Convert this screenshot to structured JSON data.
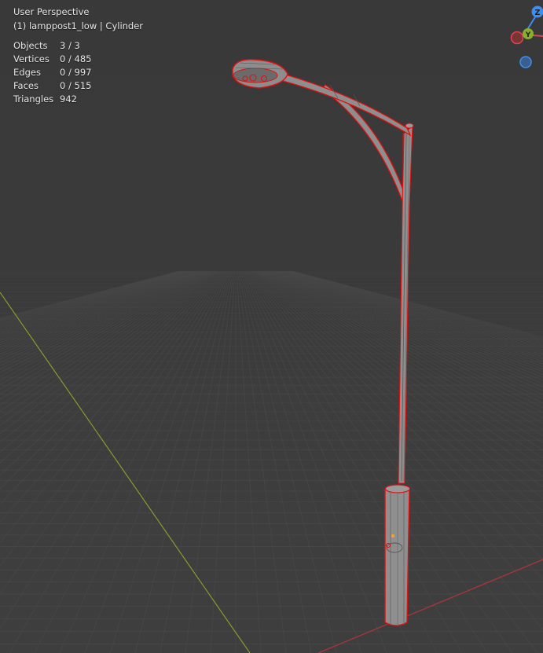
{
  "viewport": {
    "view_name": "User Perspective",
    "object_info": "(1) lamppost1_low | Cylinder"
  },
  "stats": [
    {
      "label": "Objects",
      "value": "3 / 3"
    },
    {
      "label": "Vertices",
      "value": "0 / 485"
    },
    {
      "label": "Edges",
      "value": "0 / 997"
    },
    {
      "label": "Faces",
      "value": "0 / 515"
    },
    {
      "label": "Triangles",
      "value": "942"
    }
  ],
  "gizmo": {
    "z_label": "Z",
    "y_label": "Y",
    "x_color": "#e0444e",
    "y_color": "#8bad2c",
    "z_color": "#3d8ef0"
  },
  "colors": {
    "background": "#3a3a3a",
    "grid": "#4a4a4a",
    "x_axis": "#a8363e",
    "y_axis": "#8a9a2e",
    "mesh_fill": "#8e8e8e",
    "selection_outline": "#e01010"
  }
}
